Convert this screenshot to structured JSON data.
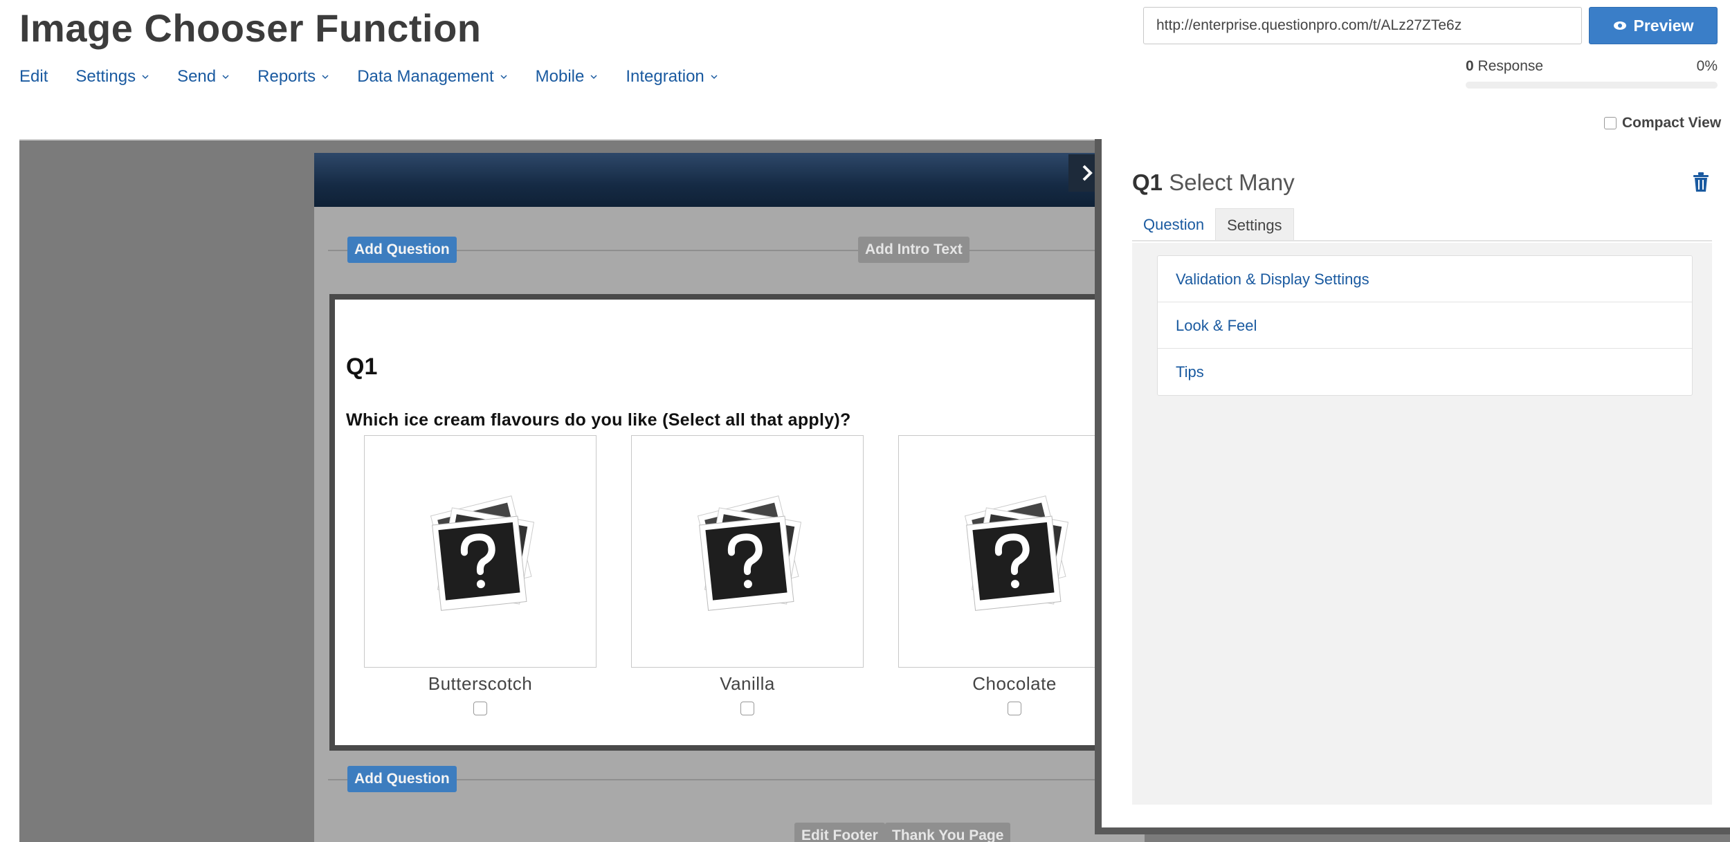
{
  "header": {
    "title": "Image Chooser Function",
    "url": "http://enterprise.questionpro.com/t/ALz27ZTe6z",
    "preview_label": "Preview"
  },
  "nav": [
    {
      "label": "Edit",
      "dropdown": false
    },
    {
      "label": "Settings",
      "dropdown": true
    },
    {
      "label": "Send",
      "dropdown": true
    },
    {
      "label": "Reports",
      "dropdown": true
    },
    {
      "label": "Data Management",
      "dropdown": true
    },
    {
      "label": "Mobile",
      "dropdown": true
    },
    {
      "label": "Integration",
      "dropdown": true
    }
  ],
  "responses": {
    "count": "0",
    "label": "Response",
    "percent": "0%",
    "progress": 0
  },
  "compact_view_label": "Compact View",
  "survey": {
    "add_question_label": "Add Question",
    "add_intro_label": "Add Intro Text",
    "edit_footer_label": "Edit Footer",
    "thank_you_label": "Thank You Page",
    "question": {
      "number": "Q1",
      "text": "Which ice cream flavours do you like (Select all that apply)?",
      "options": [
        "Butterscotch",
        "Vanilla",
        "Chocolate"
      ]
    }
  },
  "panel": {
    "qnum": "Q1",
    "qtype": "Select Many",
    "tabs": [
      "Question",
      "Settings"
    ],
    "active_tab": "Settings",
    "settings_items": [
      "Validation & Display Settings",
      "Look & Feel",
      "Tips"
    ]
  },
  "colors": {
    "accent": "#3a7ec8",
    "link": "#1a5aa0",
    "overlay": "#7b7b7b"
  }
}
